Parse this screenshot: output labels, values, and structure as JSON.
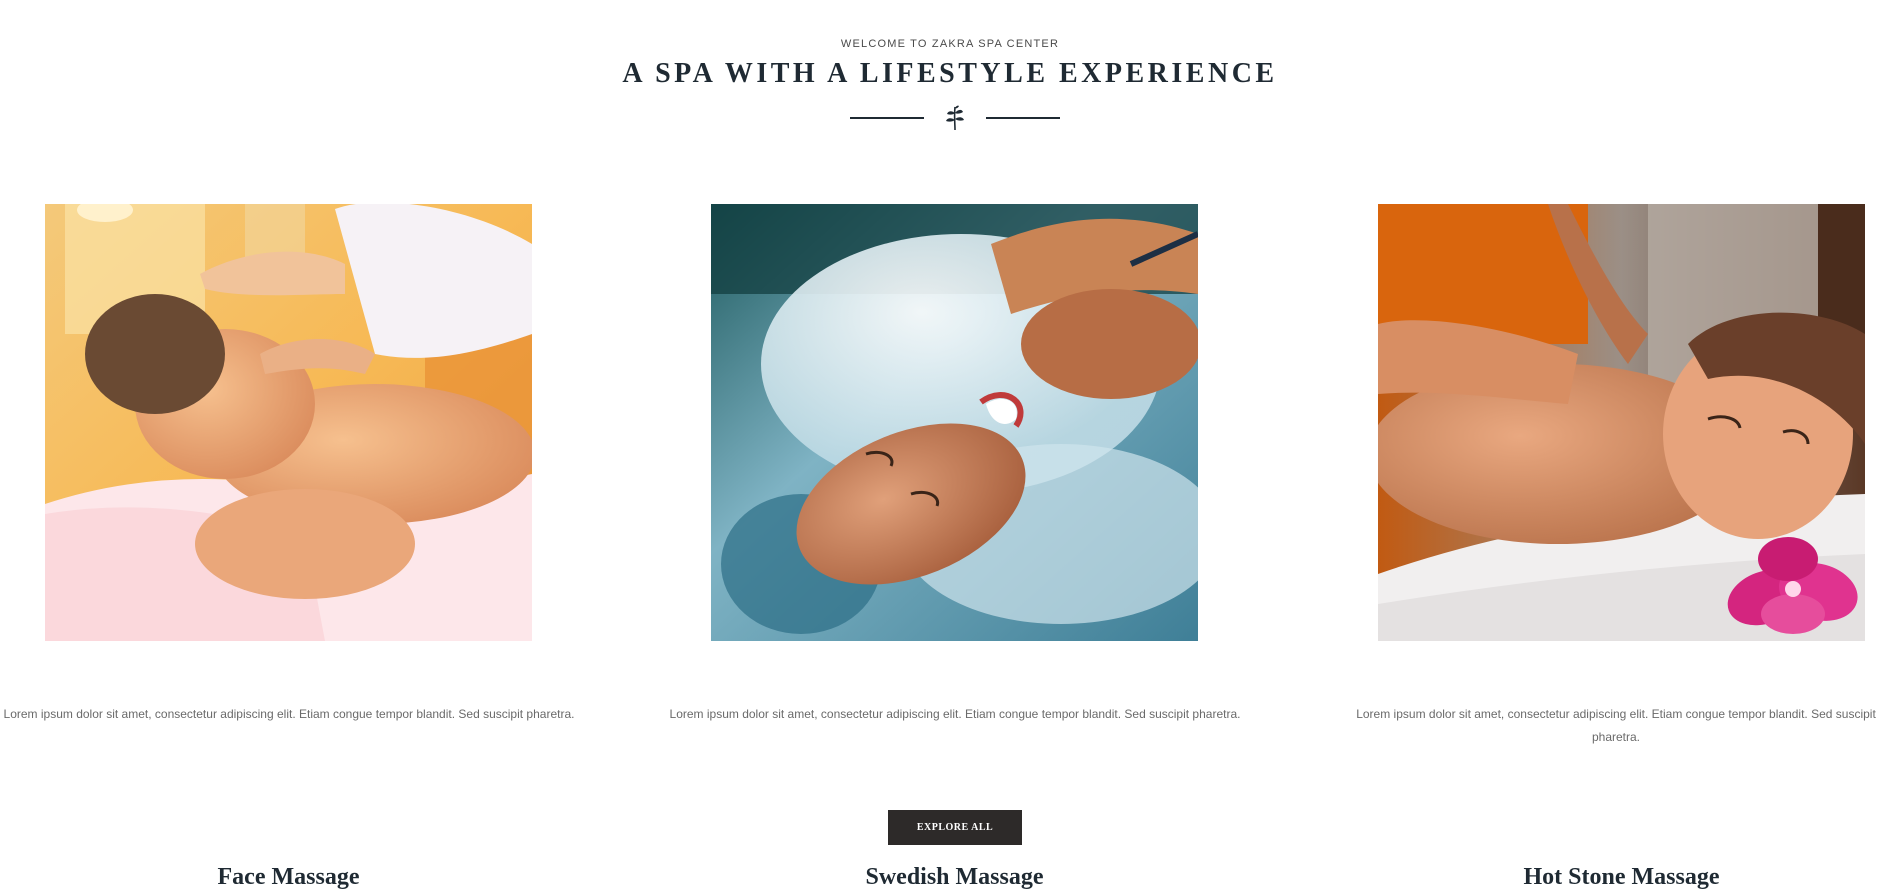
{
  "intro": {
    "eyebrow": "WELCOME TO ZAKRA SPA CENTER",
    "headline": "A SPA WITH A LIFESTYLE EXPERIENCE",
    "divider_icon": "leaf-icon"
  },
  "services": [
    {
      "title": "Face Massage",
      "description": "Lorem ipsum dolor sit amet, consectetur adipiscing elit. Etiam congue tempor blandit. Sed suscipit pharetra."
    },
    {
      "title": "Swedish Massage",
      "description": "Lorem ipsum dolor sit amet, consectetur adipiscing elit. Etiam congue tempor blandit. Sed suscipit pharetra."
    },
    {
      "title": "Hot Stone Massage",
      "description": "Lorem ipsum dolor sit amet, consectetur adipiscing elit. Etiam congue tempor blandit. Sed suscipit pharetra."
    }
  ],
  "cta": {
    "label": "EXPLORE ALL"
  },
  "colors": {
    "heading": "#1f2a33",
    "body_text": "#6a6a6a",
    "button_bg": "#2d2a29",
    "button_text": "#ffffff"
  }
}
